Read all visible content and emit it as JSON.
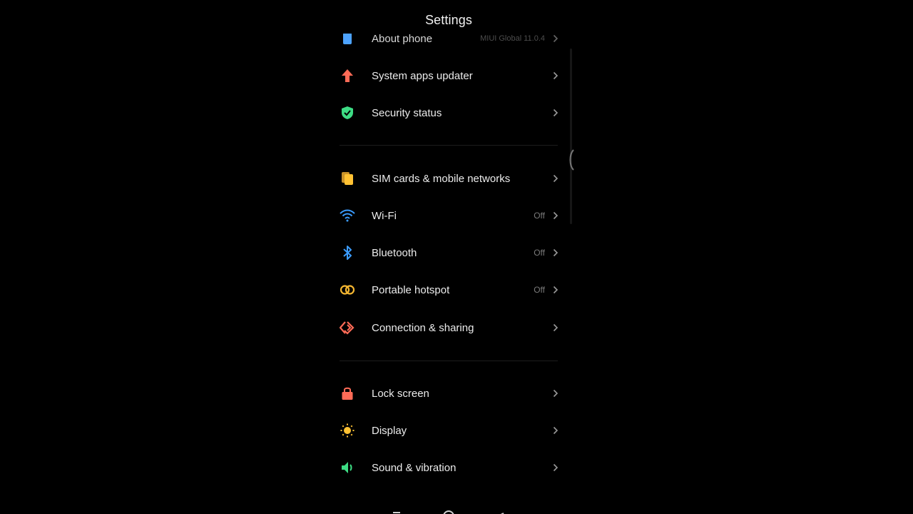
{
  "header": {
    "title": "Settings"
  },
  "items": [
    {
      "label": "About phone",
      "value": "MIUI Global 11.0.4",
      "icon": "phone-icon",
      "color": "#4da3ff"
    },
    {
      "label": "System apps updater",
      "value": "",
      "icon": "arrow-up-icon",
      "color": "#ff6b57"
    },
    {
      "label": "Security status",
      "value": "",
      "icon": "shield-check-icon",
      "color": "#3ddc84"
    },
    {
      "label": "SIM cards & mobile networks",
      "value": "",
      "icon": "sim-card-icon",
      "color": "#ffc233"
    },
    {
      "label": "Wi-Fi",
      "value": "Off",
      "icon": "wifi-icon",
      "color": "#3b9cff"
    },
    {
      "label": "Bluetooth",
      "value": "Off",
      "icon": "bluetooth-icon",
      "color": "#3b9cff"
    },
    {
      "label": "Portable hotspot",
      "value": "Off",
      "icon": "hotspot-icon",
      "color": "#f5b731"
    },
    {
      "label": "Connection & sharing",
      "value": "",
      "icon": "connection-sharing-icon",
      "color": "#ff6b57"
    },
    {
      "label": "Lock screen",
      "value": "",
      "icon": "lock-icon",
      "color": "#ff6b57"
    },
    {
      "label": "Display",
      "value": "",
      "icon": "sun-icon",
      "color": "#ffc233"
    },
    {
      "label": "Sound & vibration",
      "value": "",
      "icon": "speaker-icon",
      "color": "#3ddc84"
    }
  ],
  "theme": {
    "background": "#000000",
    "text": "#ececec",
    "secondary": "#7a7a7a",
    "chevron": "#9a9a9a"
  }
}
